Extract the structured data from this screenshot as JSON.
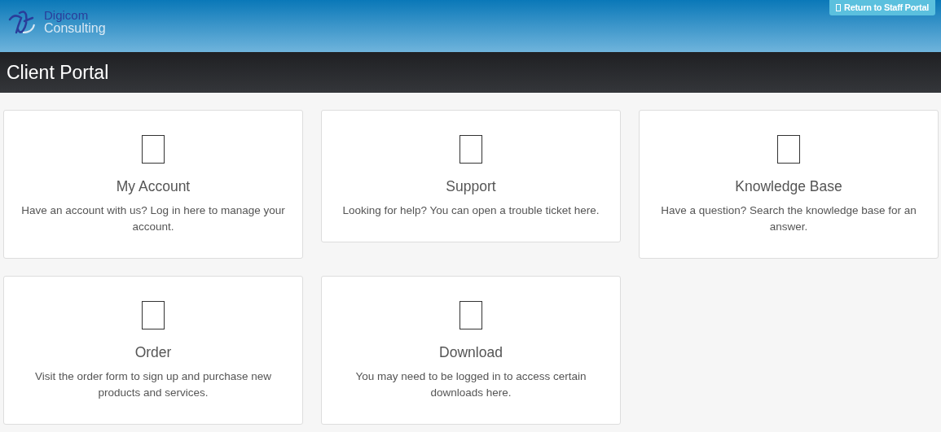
{
  "logo": {
    "line_1": "Digicom",
    "line_2": "Consulting"
  },
  "staff_button": {
    "label": "Return to Staff Portal"
  },
  "title_bar": {
    "title": "Client Portal"
  },
  "cards": [
    {
      "title": "My Account",
      "description": "Have an account with us? Log in here to manage your account."
    },
    {
      "title": "Support",
      "description": "Looking for help? You can open a trouble ticket here."
    },
    {
      "title": "Knowledge Base",
      "description": "Have a question? Search the knowledge base for an answer."
    },
    {
      "title": "Order",
      "description": "Visit the order form to sign up and purchase new products and services."
    },
    {
      "title": "Download",
      "description": "You may need to be logged in to access certain downloads here."
    }
  ]
}
